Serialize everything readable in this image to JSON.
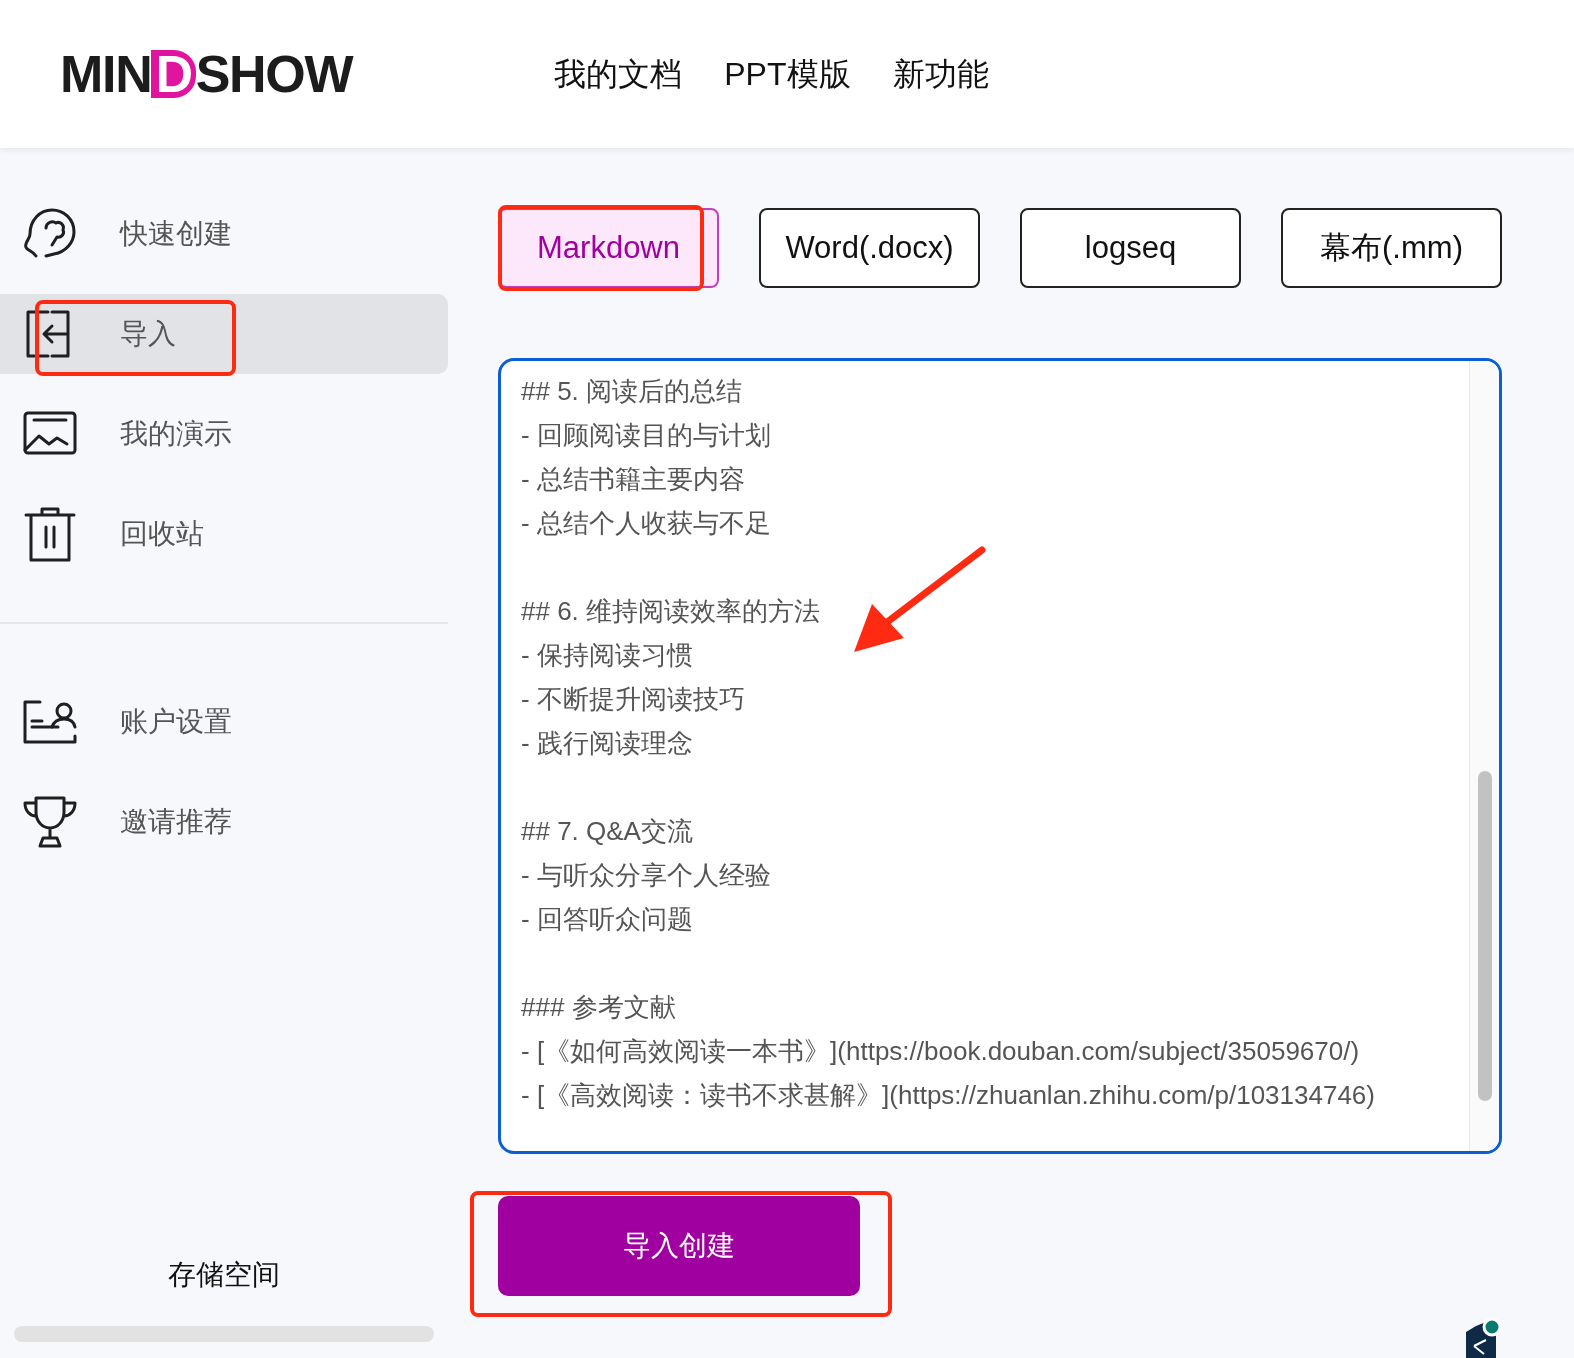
{
  "header": {
    "logo": "MINDSHOW",
    "nav": [
      {
        "label": "我的文档"
      },
      {
        "label": "PPT模版"
      },
      {
        "label": "新功能"
      }
    ]
  },
  "sidebar": {
    "items": [
      {
        "label": "快速创建",
        "selected": false
      },
      {
        "label": "导入",
        "selected": true
      },
      {
        "label": "我的演示",
        "selected": false
      },
      {
        "label": "回收站",
        "selected": false
      }
    ],
    "account_items": [
      {
        "label": "账户设置"
      },
      {
        "label": "邀请推荐"
      }
    ],
    "storage": {
      "label": "存储空间"
    }
  },
  "formats": [
    {
      "label": "Markdown",
      "selected": true
    },
    {
      "label": "Word(.docx)",
      "selected": false
    },
    {
      "label": "logseq",
      "selected": false
    },
    {
      "label": "幕布(.mm)",
      "selected": false
    }
  ],
  "editor": {
    "sections": [
      {
        "lines": [
          "## 5. 阅读后的总结",
          "- 回顾阅读目的与计划",
          "- 总结书籍主要内容",
          "- 总结个人收获与不足"
        ]
      },
      {
        "lines": [
          "## 6. 维持阅读效率的方法",
          "- 保持阅读习惯",
          "- 不断提升阅读技巧",
          "- 践行阅读理念"
        ]
      },
      {
        "lines": [
          "## 7. Q&A交流",
          "- 与听众分享个人经验",
          "- 回答听众问题"
        ]
      },
      {
        "lines": [
          "### 参考文献",
          "- [《如何高效阅读一本书》](https://book.douban.com/subject/35059670/)",
          "- [《高效阅读：读书不求甚解》](https://zhuanlan.zhihu.com/p/103134746)"
        ]
      }
    ]
  },
  "submit": {
    "label": "导入创建"
  }
}
